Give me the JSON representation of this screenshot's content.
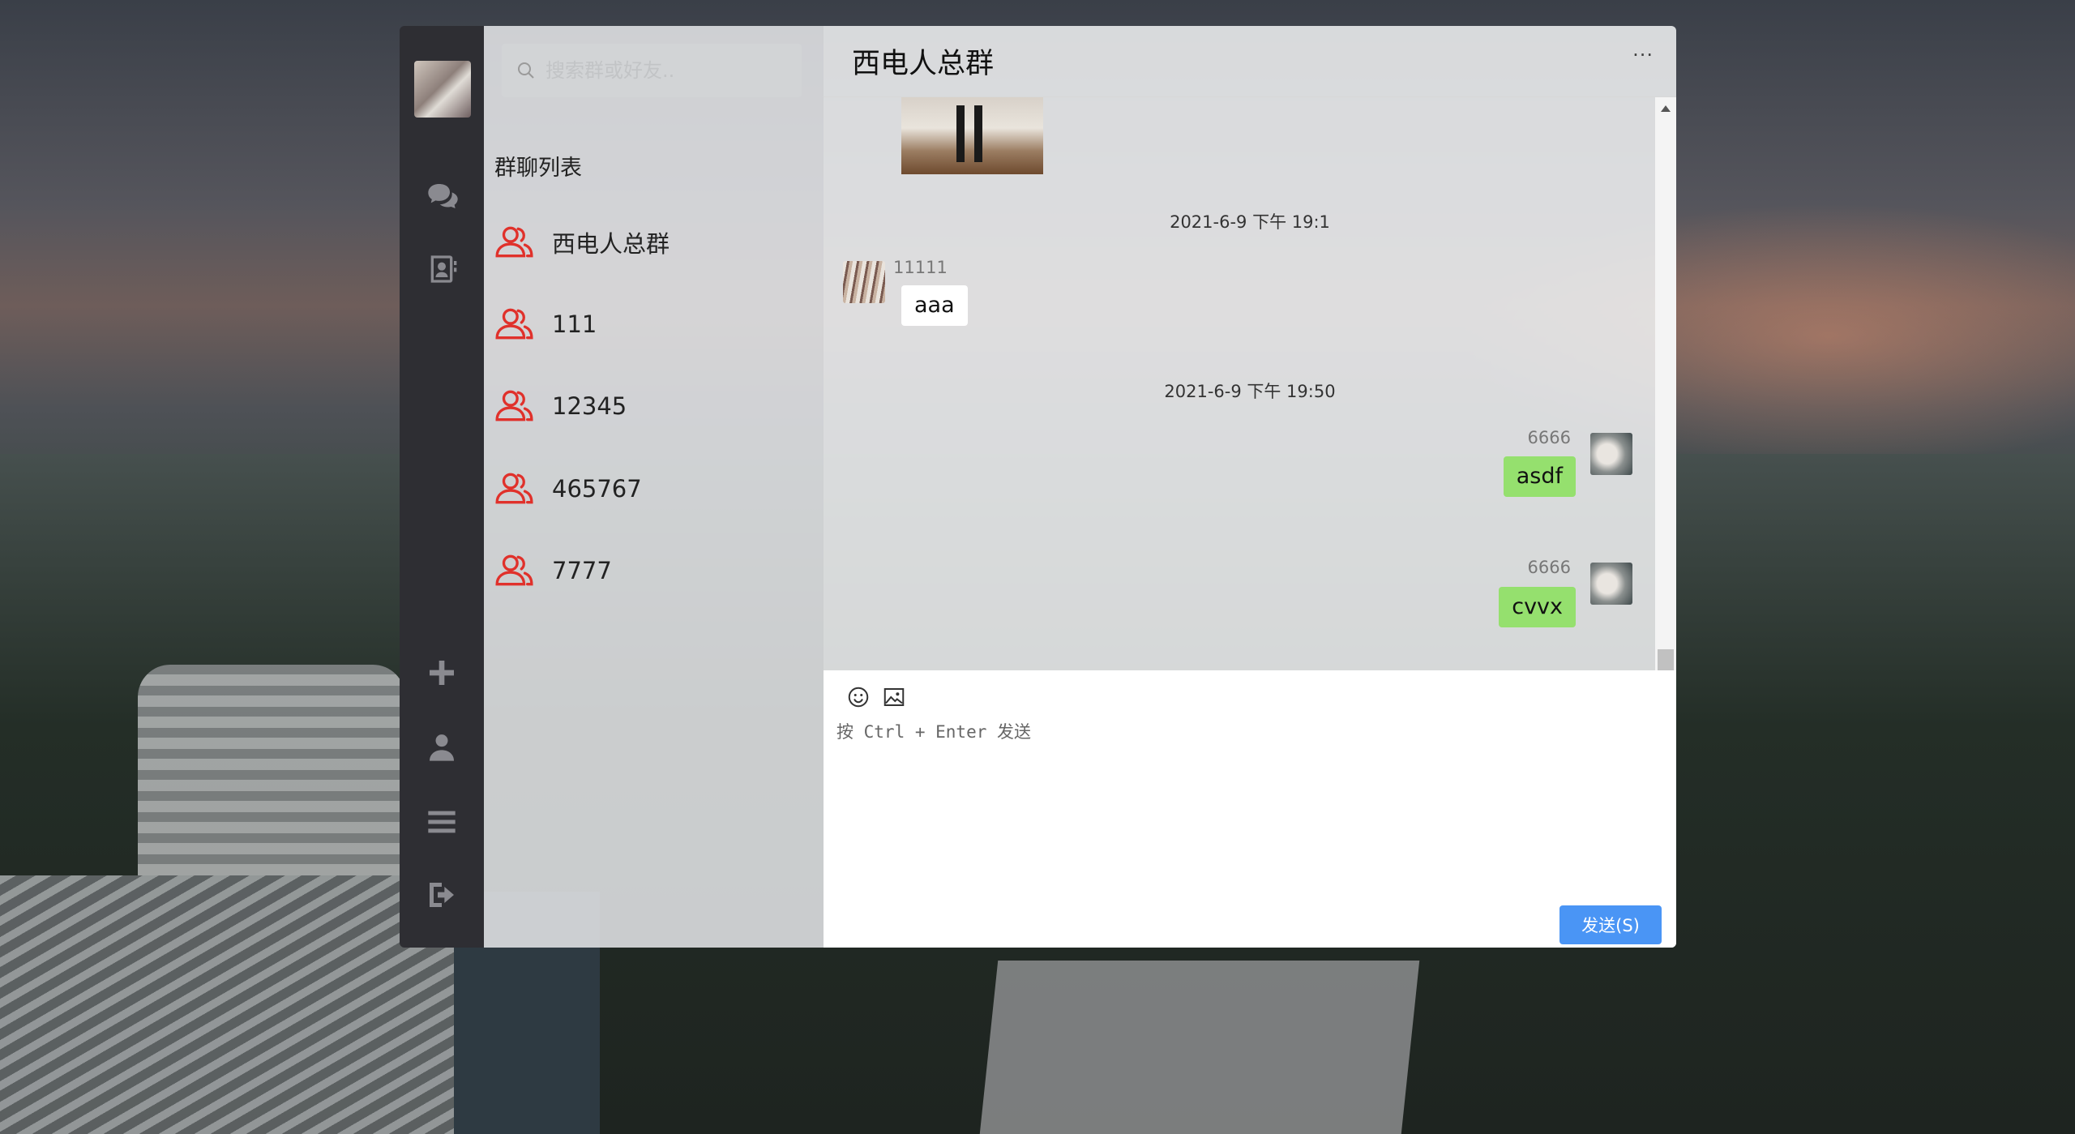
{
  "background": {
    "accent": "#4a95f5"
  },
  "rail": {
    "icons": [
      "chat-icon",
      "contacts-icon",
      "plus-icon",
      "user-icon",
      "menu-icon",
      "logout-icon"
    ]
  },
  "search": {
    "placeholder": "搜索群或好友.."
  },
  "groups": {
    "title": "群聊列表",
    "items": [
      {
        "name": "西电人总群"
      },
      {
        "name": "111"
      },
      {
        "name": "12345"
      },
      {
        "name": "465767"
      },
      {
        "name": "7777"
      }
    ]
  },
  "chat": {
    "title": "西电人总群",
    "more": "···",
    "messages": [
      {
        "time": "2021-6-9 下午 19:1",
        "sender": "11111",
        "text": "aaa",
        "side": "left"
      },
      {
        "time": "2021-6-9 下午 19:50",
        "sender": "6666",
        "text": "asdf",
        "side": "right"
      },
      {
        "sender": "6666",
        "text": "cvvx",
        "side": "right"
      }
    ],
    "composer_placeholder": "按 Ctrl + Enter 发送",
    "send_label": "发送(S)"
  }
}
